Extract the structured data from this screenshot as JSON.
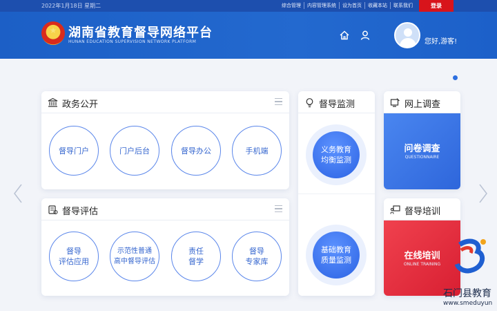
{
  "topbar": {
    "date": "2022年1月18日 星期二",
    "links": [
      "综合管理",
      "内容管理系统",
      "设为首页",
      "收藏本站",
      "联系我们"
    ],
    "login": "登录"
  },
  "header": {
    "title": "湖南省教育督导网络平台",
    "subtitle": "HUNAN EDUCATION SUPERVISION NETWORK PLATFORM",
    "greeting": "您好,游客!"
  },
  "cards": {
    "gov": {
      "title": "政务公开",
      "items": [
        "督导门户",
        "门户后台",
        "督导办公",
        "手机端"
      ]
    },
    "eval": {
      "title": "督导评估",
      "items": [
        "督导\n评估应用",
        "示范性普通\n高中督导评估",
        "责任\n督学",
        "督导\n专家库"
      ]
    },
    "monitor": {
      "title": "督导监测",
      "items": [
        "义务教育\n均衡监测",
        "基础教育\n质量监测"
      ]
    },
    "survey": {
      "title": "网上调查",
      "banner": "问卷调查",
      "banner_en": "QUESTIONNAIRE"
    },
    "training": {
      "title": "督导培训",
      "banner": "在线培训",
      "banner_en": "ONLINE TRAINING"
    }
  },
  "watermark": {
    "name": "石门县教育",
    "url": "www.smeduyun"
  },
  "colors": {
    "header": "#1c5fc6",
    "accent": "#2d6fe0",
    "login": "#d8141b",
    "survey": "#3a73e6",
    "training": "#e8273a"
  }
}
